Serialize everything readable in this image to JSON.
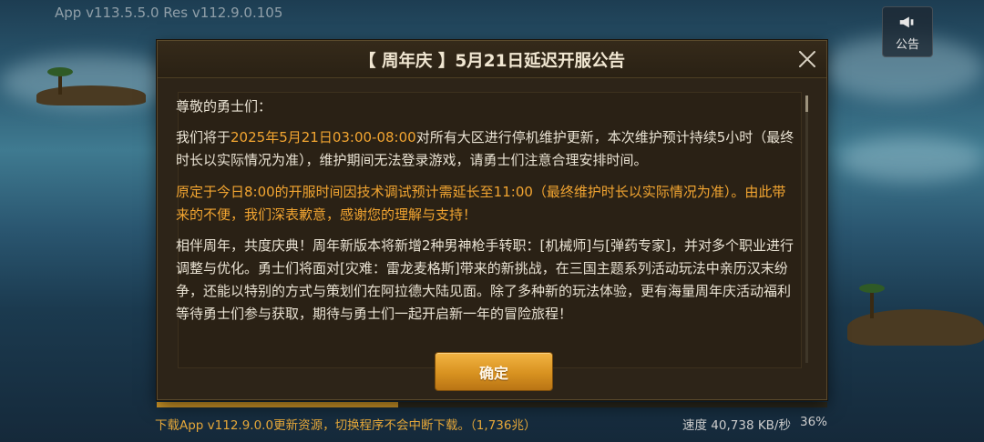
{
  "version_text": "App v113.5.5.0 Res v112.9.0.105",
  "notice_button": {
    "label": "公告",
    "icon": "megaphone-icon"
  },
  "dialog": {
    "title": "【 周年庆 】5月21日延迟开服公告",
    "greeting": "尊敬的勇士们：",
    "para1_prefix": "我们将于",
    "para1_highlight": "2025年5月21日03:00-08:00",
    "para1_suffix": "对所有大区进行停机维护更新，本次维护预计持续5小时（最终时长以实际情况为准），维护期间无法登录游戏，请勇士们注意合理安排时间。",
    "para2": "原定于今日8:00的开服时间因技术调试预计需延长至11:00（最终维护时长以实际情况为准）。由此带来的不便，我们深表歉意，感谢您的理解与支持！",
    "para3": "相伴周年，共度庆典！周年新版本将新增2种男神枪手转职：[机械师]与[弹药专家]，并对多个职业进行调整与优化。勇士们将面对[灾难：雷龙麦格斯]带来的新挑战，在三国主题系列活动玩法中亲历汉末纷争，还能以特别的方式与策划们在阿拉德大陆见面。除了多种新的玩法体验，更有海量周年庆活动福利等待勇士们参与获取，期待与勇士们一起开启新一年的冒险旅程！",
    "confirm_label": "确定"
  },
  "download": {
    "status": "下载App v112.9.0.0更新资源，切换程序不会中断下载。（1,736兆）",
    "speed": "速度 40,738 KB/秒",
    "percent": "36%",
    "progress": 0.36
  },
  "colors": {
    "accent": "#f2a531",
    "button": "#d89220",
    "dialog_bg": "#2d2418"
  }
}
